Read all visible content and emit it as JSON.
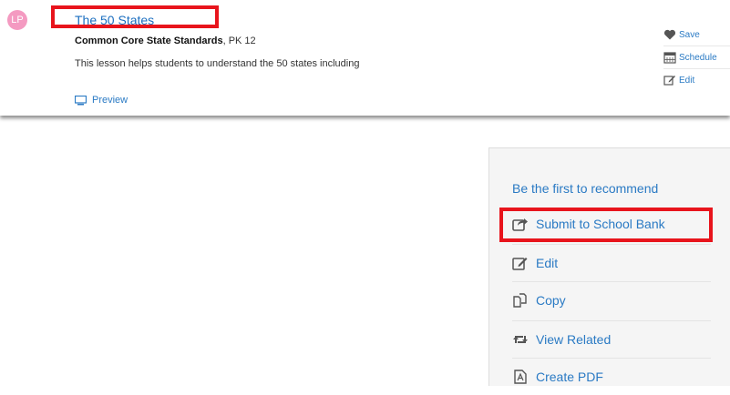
{
  "lesson": {
    "avatar_initials": "LP",
    "title": "The 50 States",
    "standards_name": "Common Core State Standards",
    "grade_range": ", PK 12",
    "description": "This lesson helps students to understand the 50 states including",
    "preview_label": "Preview",
    "actions": {
      "save": "Save",
      "schedule": "Schedule",
      "edit": "Edit"
    }
  },
  "panel": {
    "recommend_label": "Be the first to recommend",
    "items": [
      {
        "label": "Submit to School Bank",
        "icon": "share-icon"
      },
      {
        "label": "Edit",
        "icon": "pencil-icon"
      },
      {
        "label": "Copy",
        "icon": "copy-icon"
      },
      {
        "label": "View Related",
        "icon": "retweet-icon"
      },
      {
        "label": "Create PDF",
        "icon": "pdf-icon"
      }
    ]
  },
  "colors": {
    "link": "#2a7ac4",
    "highlight": "#e8141c",
    "avatar": "#f49ac1"
  }
}
